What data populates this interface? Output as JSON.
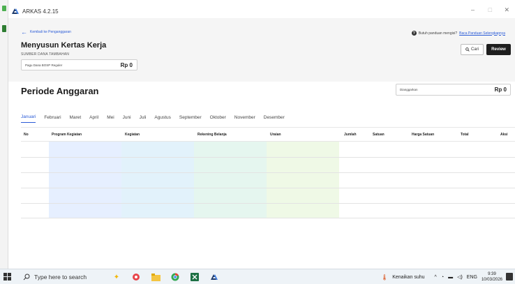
{
  "window": {
    "title": "ARKAS 4.2.15",
    "minimize": "–",
    "maximize": "□",
    "close": "✕"
  },
  "header": {
    "back_link": "Kembali ke Penganggaran",
    "page_title": "Menyusun Kertas Kerja",
    "subtitle": "SUMBER DANA TAMBAHAN",
    "pagu_label": "Pagu Dana BOSP Reguler",
    "pagu_value": "Rp 0",
    "help_text": "Butuh panduan mengisi?",
    "help_link": "Baca Panduan Selengkapnya",
    "cari_label": "Cari",
    "review_label": "Review"
  },
  "periode": {
    "title": "Periode Anggaran",
    "dianggarkan_label": "Dianggarkan",
    "dianggarkan_value": "Rp 0"
  },
  "tabs": [
    {
      "label": "Januari",
      "active": true
    },
    {
      "label": "Februari"
    },
    {
      "label": "Maret"
    },
    {
      "label": "April"
    },
    {
      "label": "Mei"
    },
    {
      "label": "Juni"
    },
    {
      "label": "Juli"
    },
    {
      "label": "Agustus"
    },
    {
      "label": "September"
    },
    {
      "label": "Oktober"
    },
    {
      "label": "November"
    },
    {
      "label": "Desember"
    }
  ],
  "table": {
    "columns": [
      "No",
      "Program Kegiatan",
      "Kegiatan",
      "Rekening Belanja",
      "Uraian",
      "Jumlah",
      "Satuan",
      "Harga Satuan",
      "Total",
      "Aksi"
    ],
    "column_colors": [
      "#e6efff",
      "#e2f2fb",
      "#e5f6ef",
      "#eff9e6"
    ]
  },
  "taskbar": {
    "search_placeholder": "Type here to search",
    "weather": "Kenaikan suhu",
    "language": "ENG",
    "time": "9:39",
    "date": "10/03/2026"
  }
}
